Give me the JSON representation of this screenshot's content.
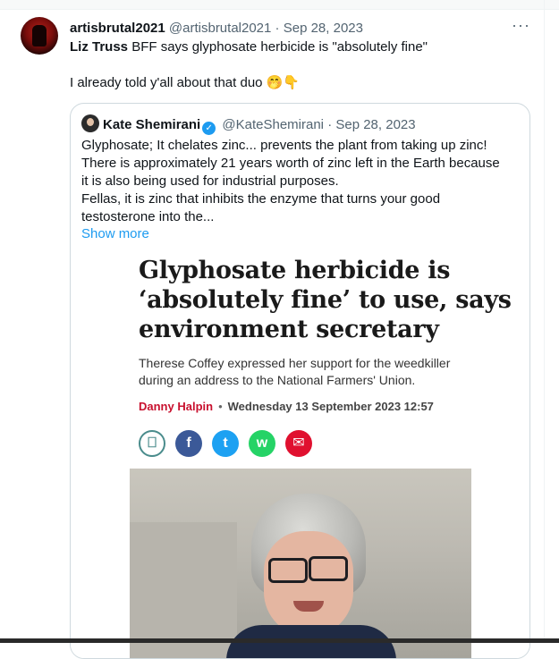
{
  "tweet": {
    "display_name": "artisbrutal2021",
    "handle": "@artisbrutal2021",
    "separator": "·",
    "date": "Sep 28, 2023",
    "more_label": "···",
    "line1_bold": "Liz Truss",
    "line1_rest": " BFF says glyphosate herbicide is \"absolutely fine\"",
    "line2": "I already told y'all about that duo",
    "emoji1": "🤭",
    "emoji2": "👇"
  },
  "quote": {
    "display_name": "Kate Shemirani",
    "verified_mark": "✓",
    "handle": "@KateShemirani",
    "separator": "·",
    "date": "Sep 28, 2023",
    "lines": [
      "Glyphosate; It chelates zinc... prevents the plant from taking up zinc!",
      "There is approximately 21 years worth of zinc left in the Earth because",
      "it is also being used for industrial purposes.",
      "Fellas, it is zinc that inhibits the enzyme that turns your good",
      "testosterone into the..."
    ],
    "show_more": "Show more"
  },
  "article": {
    "headline": [
      "Glyphosate herbicide is",
      "‘absolutely fine’ to use, says",
      "environment secretary"
    ],
    "standfirst": [
      "Therese Coffey expressed her support for the weedkiller",
      "during an address to the National Farmers' Union."
    ],
    "author": "Danny Halpin",
    "byline_sep": "•",
    "date": "Wednesday 13 September 2023 12:57",
    "share_icons": {
      "bookmark": "⎕",
      "facebook": "f",
      "twitter": "t",
      "whatsapp": "w",
      "email": "✉"
    }
  },
  "colors": {
    "link": "#1d9bf0",
    "author": "#c8102e",
    "facebook": "#3b5998",
    "twitter": "#1da1f2",
    "whatsapp": "#25d366",
    "email": "#e0102f"
  }
}
